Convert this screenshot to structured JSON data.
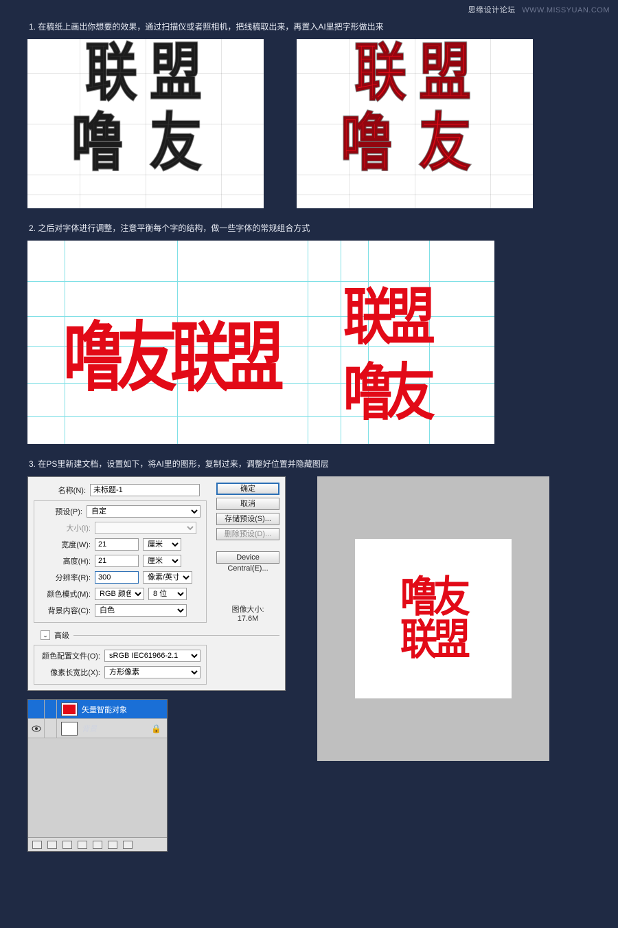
{
  "watermark": {
    "forum": "思缘设计论坛",
    "url": "WWW.MISSYUAN.COM"
  },
  "steps": {
    "s1": "1. 在稿纸上画出你想要的效果，通过扫描仪或者照相机，把线稿取出来，再置入AI里把字形做出来",
    "s2": "2. 之后对字体进行调整，注意平衡每个字的结构，做一些字体的常规组合方式",
    "s3": "3. 在PS里新建文档，设置如下，将AI里的图形，复制过来，调整好位置并隐藏图层"
  },
  "glyphs": {
    "lian": "联",
    "meng": "盟",
    "lu": "噜",
    "you": "友"
  },
  "dialog": {
    "labels": {
      "name": "名称(N):",
      "preset": "预设(P):",
      "size": "大小(I):",
      "width": "宽度(W):",
      "height": "高度(H):",
      "res": "分辨率(R):",
      "mode": "颜色模式(M):",
      "bg": "背景内容(C):",
      "adv": "高级",
      "profile": "颜色配置文件(O):",
      "pixar": "像素长宽比(X):",
      "imgsize_lbl": "图像大小:",
      "imgsize_val": "17.6M"
    },
    "values": {
      "name": "未标题-1",
      "preset": "自定",
      "width": "21",
      "height": "21",
      "res": "300",
      "unit_cm": "厘米",
      "unit_ppi": "像素/英寸",
      "mode": "RGB 颜色",
      "bits": "8 位",
      "bg": "白色",
      "profile": "sRGB IEC61966-2.1",
      "pixar": "方形像素"
    },
    "buttons": {
      "ok": "确定",
      "cancel": "取消",
      "save": "存储预设(S)...",
      "del": "删除预设(D)...",
      "dc": "Device Central(E)..."
    }
  },
  "layers": {
    "item_smart": "矢量智能对象",
    "item_bg": "背景"
  }
}
